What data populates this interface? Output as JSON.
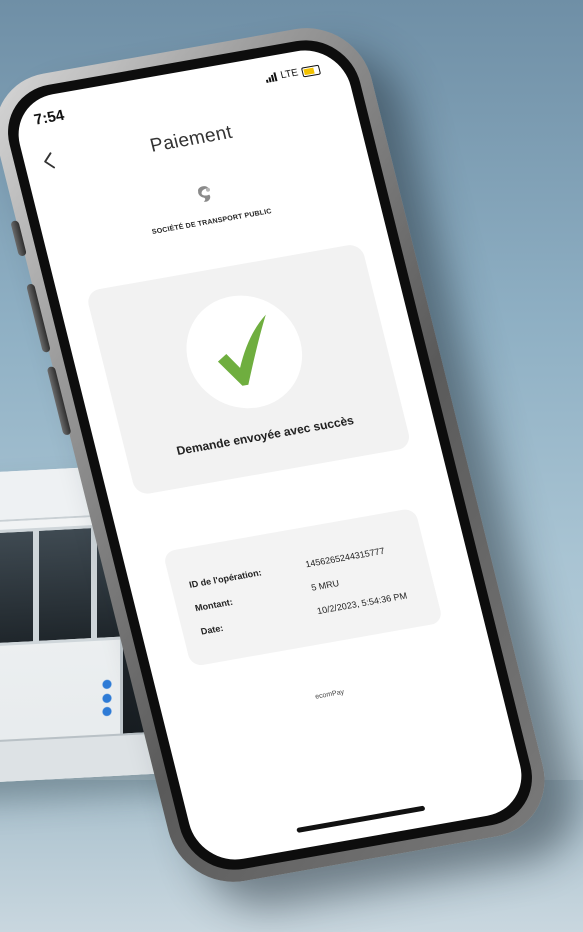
{
  "status": {
    "time": "7:54",
    "network": "LTE"
  },
  "header": {
    "title": "Paiement"
  },
  "company": {
    "name": "SOCIÉTÉ DE TRANSPORT PUBLIC"
  },
  "success": {
    "message": "Demande envoyée avec succès",
    "check_color": "#6fae3f"
  },
  "details": {
    "rows": [
      {
        "label": "ID de l'opération:",
        "value": "1456265244315777"
      },
      {
        "label": "Montant:",
        "value": "5 MRU"
      },
      {
        "label": "Date:",
        "value": "10/2/2023, 5:54:36 PM"
      }
    ]
  },
  "footer": {
    "brand": "ecomPay"
  }
}
